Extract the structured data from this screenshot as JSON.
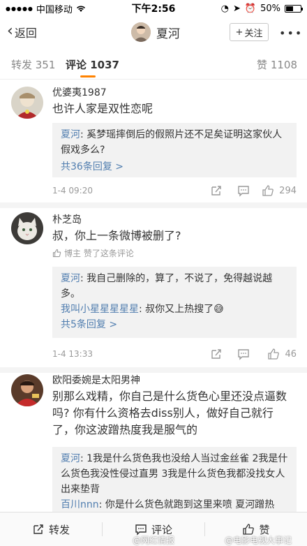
{
  "status_bar": {
    "carrier": "中国移动",
    "time": "下午2:56",
    "battery": "50%",
    "battery_level": 0.5
  },
  "nav": {
    "back_label": "返回",
    "title": "夏河",
    "follow_label": "关注",
    "more_label": "•••"
  },
  "tabs": {
    "repost": "转发 351",
    "comment": "评论 1037",
    "like": "赞 1108"
  },
  "comments": [
    {
      "name": "优婆夷1987",
      "text": "也许人家是双性恋呢",
      "replies": [
        {
          "name": "夏河",
          "text": ": 奚梦瑶摔倒后的假照片还不足矣证明这家伙人假戏多么?"
        }
      ],
      "more_replies": "共36条回复 >",
      "time": "1-4 09:20",
      "likes": "294"
    },
    {
      "name": "朴芝岛",
      "text": "叔，你上一条微博被删了?",
      "author_liked": "博主 赞了这条评论",
      "replies": [
        {
          "name": "夏河",
          "text": ": 我自己删除的，算了，不说了，免得越说越多。"
        },
        {
          "name": "我叫小星星星星星",
          "text": ": 叔你又上热搜了😅"
        }
      ],
      "more_replies": "共5条回复 >",
      "time": "1-4 13:33",
      "likes": "46"
    },
    {
      "name": "欧阳委婉是太阳男神",
      "text": "别那么戏精，你自己是什么货色心里还没点逼数吗? 你有什么资格去diss别人，做好自己就行了，你这波蹭热度我是服气的",
      "replies": [
        {
          "name": "夏河",
          "text": ": 1我是什么货色我也没给人当过金丝雀 2我是什么货色我没性侵过直男 3我是什么货色我都没找女人出来垫背"
        },
        {
          "name": "百川nnn",
          "text": ": 你是什么货色就跑到这里来喷  夏河蹭热"
        }
      ]
    }
  ],
  "bottom_bar": {
    "repost": "转发",
    "comment": "评论",
    "like": "赞"
  },
  "watermarks": {
    "left": "@网红情报",
    "right": "@电影电视大事记"
  },
  "colors": {
    "accent": "#ff8200",
    "link": "#507daf",
    "text": "#333333",
    "meta": "#999999"
  }
}
